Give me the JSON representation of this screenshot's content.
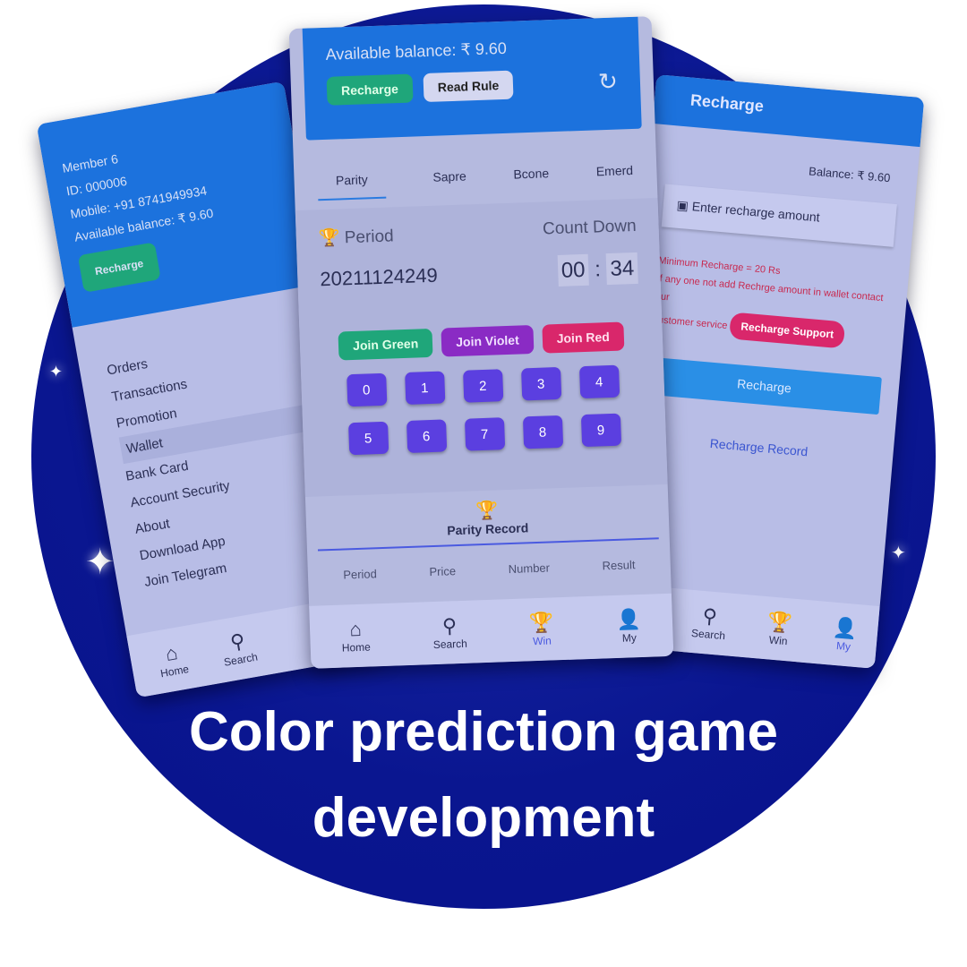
{
  "left_screen": {
    "member": "Member 6",
    "id": "ID: 000006",
    "mobile": "Mobile: +91 8741949934",
    "balance": "Available balance: ₹ 9.60",
    "recharge": "Recharge",
    "menu": [
      "Orders",
      "Transactions",
      "Promotion",
      "Wallet",
      "Bank Card",
      "Account Security",
      "About",
      "Download App",
      "Join Telegram"
    ],
    "nav": [
      "Home",
      "Search"
    ]
  },
  "center_screen": {
    "balance": "Available balance: ₹ 9.60",
    "recharge": "Recharge",
    "read_rule": "Read Rule",
    "tabs": [
      "Parity",
      "Sapre",
      "Bcone",
      "Emerd"
    ],
    "period_label": "Period",
    "countdown_label": "Count Down",
    "period": "20211124249",
    "countdown_min": "00",
    "countdown_sec": "34",
    "join": [
      "Join Green",
      "Join Violet",
      "Join Red"
    ],
    "numbers": [
      "0",
      "1",
      "2",
      "3",
      "4",
      "5",
      "6",
      "7",
      "8",
      "9"
    ],
    "record_title": "Parity Record",
    "columns": [
      "Period",
      "Price",
      "Number",
      "Result"
    ],
    "nav": [
      "Home",
      "Search",
      "Win",
      "My"
    ]
  },
  "right_screen": {
    "title": "Recharge",
    "balance": "Balance: ₹ 9.60",
    "placeholder": "Enter recharge amount",
    "note_1": "Minimum Recharge = 20 Rs",
    "note_2": "If any one not add Rechrge amount in wallet contact our",
    "note_3": "customer service",
    "support": "Recharge Support",
    "recharge": "Recharge",
    "record": "Recharge Record",
    "nav": [
      "Search",
      "Win",
      "My"
    ]
  },
  "caption": {
    "line1": "Color prediction game",
    "line2": "development"
  },
  "colors": {
    "header": "#1c72dd",
    "green": "#1fa67a",
    "violet": "#8a2bc4",
    "red": "#d9276b",
    "number": "#5b3fe0",
    "background": "#0a1690"
  }
}
